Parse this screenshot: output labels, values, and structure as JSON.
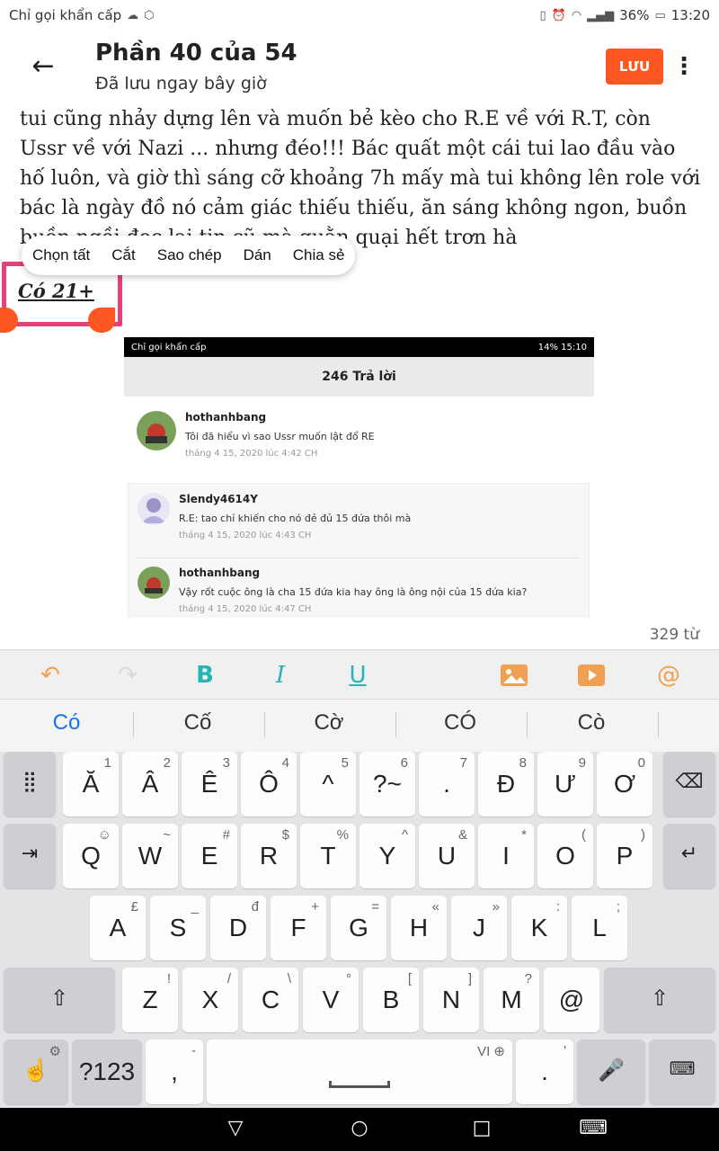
{
  "status_bar": {
    "carrier": "Chỉ gọi khẩn cấp",
    "battery": "36%",
    "time": "13:20"
  },
  "header": {
    "title": "Phần 40 của 54",
    "subtitle": "Đã lưu ngay bây giờ",
    "save_label": "LƯU"
  },
  "story": {
    "text": "tui cũng nhảy dựng lên và muốn bẻ kèo cho R.E về với R.T, còn Ussr về với Nazi ... nhưng đéo!!! Bác quất một cái tui lao đầu vào hố luôn, và giờ thì sáng cỡ khoảng 7h mấy mà tui không lên role với bác là ngày đồ nó cảm giác thiếu thiếu, ăn sáng không ngon, buồn buồn ngồi đọc lại tin cũ mà quằn quại hết trơn hà",
    "selected": "Có 21+"
  },
  "context_menu": {
    "items": [
      "Chọn tất",
      "Cắt",
      "Sao chép",
      "Dán",
      "Chia sẻ"
    ]
  },
  "embedded": {
    "status_left": "Chỉ gọi khẩn cấp",
    "status_right": "14% 15:10",
    "header": "246 Trả lời",
    "comments": [
      {
        "name": "hothanhbang",
        "message": "Tôi đã hiểu vì sao Ussr muốn lật đổ RE",
        "date": "tháng 4 15, 2020 lúc 4:42 CH"
      },
      {
        "name": "Slendy4614Y",
        "message": "R.E: tao chỉ khiến cho nó đẻ đủ 15 đứa thôi mà",
        "date": "tháng 4 15, 2020 lúc 4:43 CH"
      },
      {
        "name": "hothanhbang",
        "message": "Vậy rốt cuộc ông là cha 15 đứa kia hay ông là ông nội của 15 đứa kia?",
        "date": "tháng 4 15, 2020 lúc 4:47 CH"
      }
    ]
  },
  "word_count": "329 từ",
  "toolbar": {
    "bold": "B",
    "italic": "I",
    "underline": "U",
    "mention": "@"
  },
  "suggestions": [
    "Có",
    "Cố",
    "Cờ",
    "CÓ",
    "Cò"
  ],
  "keyboard": {
    "row1": [
      {
        "k": "Ă",
        "h": "1"
      },
      {
        "k": "Â",
        "h": "2"
      },
      {
        "k": "Ê",
        "h": "3"
      },
      {
        "k": "Ô",
        "h": "4"
      },
      {
        "k": "^",
        "h": "5"
      },
      {
        "k": "?~",
        "h": "6"
      },
      {
        "k": ".",
        "h": "7"
      },
      {
        "k": "Đ",
        "h": "8"
      },
      {
        "k": "Ư",
        "h": "9"
      },
      {
        "k": "Ơ",
        "h": "0"
      }
    ],
    "row2": [
      {
        "k": "Q",
        "h": "☺"
      },
      {
        "k": "W",
        "h": "~"
      },
      {
        "k": "E",
        "h": "#"
      },
      {
        "k": "R",
        "h": "$"
      },
      {
        "k": "T",
        "h": "%"
      },
      {
        "k": "Y",
        "h": "^"
      },
      {
        "k": "U",
        "h": "&"
      },
      {
        "k": "I",
        "h": "*"
      },
      {
        "k": "O",
        "h": "("
      },
      {
        "k": "P",
        "h": ")"
      }
    ],
    "row3": [
      {
        "k": "A",
        "h": "£"
      },
      {
        "k": "S",
        "h": "_"
      },
      {
        "k": "D",
        "h": "đ"
      },
      {
        "k": "F",
        "h": "+"
      },
      {
        "k": "G",
        "h": "="
      },
      {
        "k": "H",
        "h": "«"
      },
      {
        "k": "J",
        "h": "»"
      },
      {
        "k": "K",
        "h": ":"
      },
      {
        "k": "L",
        "h": ";"
      }
    ],
    "row4": [
      {
        "k": "Z",
        "h": "!"
      },
      {
        "k": "X",
        "h": "/"
      },
      {
        "k": "C",
        "h": "\\"
      },
      {
        "k": "V",
        "h": "°"
      },
      {
        "k": "B",
        "h": "["
      },
      {
        "k": "N",
        "h": "]"
      },
      {
        "k": "M",
        "h": "?"
      },
      {
        "k": "@",
        "h": ""
      }
    ],
    "sym_label": "?123",
    "comma": ",",
    "comma_hint": "-",
    "space_lang": "VI",
    "period": ".",
    "period_hint": "'"
  },
  "colors": {
    "accent": "#ff5722",
    "selection": "#e8407a",
    "toolbar_orange": "#f0a050",
    "toolbar_teal": "#26b5b5"
  }
}
